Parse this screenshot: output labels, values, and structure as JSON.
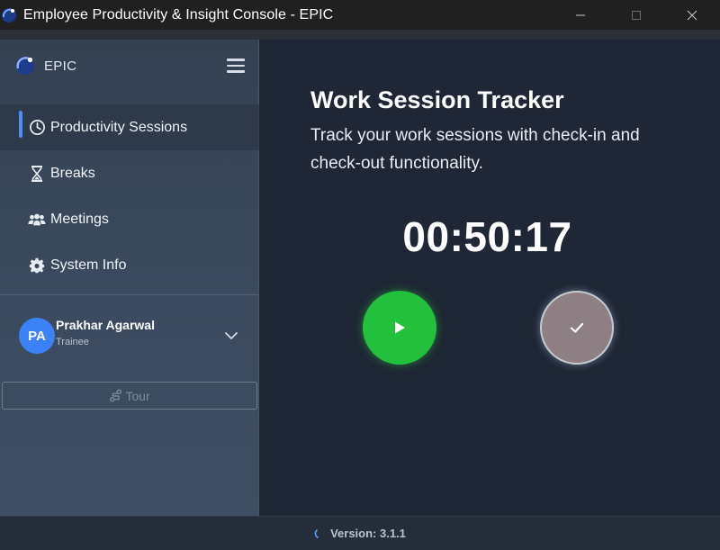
{
  "window": {
    "title": "Employee Productivity & Insight Console - EPIC",
    "controls": [
      "minimize-icon",
      "maximize-icon",
      "close-icon"
    ]
  },
  "sidebar": {
    "brand": "EPIC",
    "items": [
      {
        "label": "Productivity Sessions",
        "icon": "clock-icon",
        "active": true
      },
      {
        "label": "Breaks",
        "icon": "hourglass-icon",
        "active": false
      },
      {
        "label": "Meetings",
        "icon": "users-icon",
        "active": false
      },
      {
        "label": "System Info",
        "icon": "gear-icon",
        "active": false
      }
    ],
    "user": {
      "initials": "PA",
      "name": "Prakhar Agarwal",
      "role": "Trainee"
    },
    "tour_label": "Tour"
  },
  "main": {
    "title": "Work Session Tracker",
    "description": "Track your work sessions with check-in and check-out functionality.",
    "timer": "00:50:17",
    "checkin_icon": "play-icon",
    "checkout_icon": "check-icon"
  },
  "footer": {
    "version": "Version: 3.1.1"
  },
  "colors": {
    "accent": "#4c8df6",
    "checkin": "#22c03b",
    "checkout": "#8d7f84",
    "avatar": "#3b82f6"
  }
}
